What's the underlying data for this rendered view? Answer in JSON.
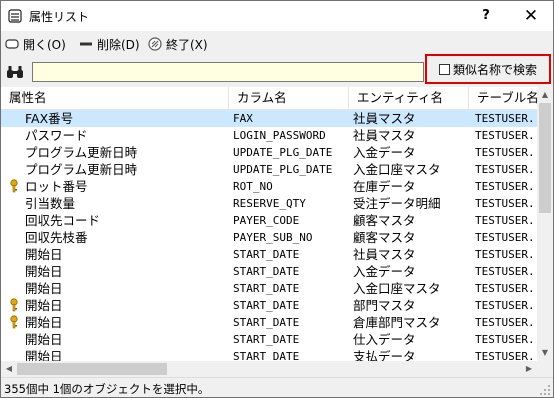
{
  "window": {
    "title": "属性リスト",
    "help": "?",
    "close": "✕"
  },
  "toolbar": {
    "open_label": "開く(O)",
    "delete_label": "削除(D)",
    "exit_label": "終了(X)"
  },
  "search": {
    "value": "",
    "similar_label": "類似名称で検索",
    "similar_checked": false
  },
  "table": {
    "columns": [
      "属性名",
      "カラム名",
      "エンティティ名",
      "テーブル名"
    ],
    "rows": [
      {
        "attr": "FAX番号",
        "column": "FAX",
        "entity": "社員マスタ",
        "table": "TESTUSER.",
        "key": false,
        "selected": true
      },
      {
        "attr": "パスワード",
        "column": "LOGIN_PASSWORD",
        "entity": "社員マスタ",
        "table": "TESTUSER.",
        "key": false
      },
      {
        "attr": "プログラム更新日時",
        "column": "UPDATE_PLG_DATE",
        "entity": "入金データ",
        "table": "TESTUSER.",
        "key": false
      },
      {
        "attr": "プログラム更新日時",
        "column": "UPDATE_PLG_DATE",
        "entity": "入金口座マスタ",
        "table": "TESTUSER.",
        "key": false
      },
      {
        "attr": "ロット番号",
        "column": "ROT_NO",
        "entity": "在庫データ",
        "table": "TESTUSER.",
        "key": true
      },
      {
        "attr": "引当数量",
        "column": "RESERVE_QTY",
        "entity": "受注データ明細",
        "table": "TESTUSER.",
        "key": false
      },
      {
        "attr": "回収先コード",
        "column": "PAYER_CODE",
        "entity": "顧客マスタ",
        "table": "TESTUSER.",
        "key": false
      },
      {
        "attr": "回収先枝番",
        "column": "PAYER_SUB_NO",
        "entity": "顧客マスタ",
        "table": "TESTUSER.",
        "key": false
      },
      {
        "attr": "開始日",
        "column": "START_DATE",
        "entity": "社員マスタ",
        "table": "TESTUSER.",
        "key": false
      },
      {
        "attr": "開始日",
        "column": "START_DATE",
        "entity": "入金データ",
        "table": "TESTUSER.",
        "key": false
      },
      {
        "attr": "開始日",
        "column": "START_DATE",
        "entity": "入金口座マスタ",
        "table": "TESTUSER.",
        "key": false
      },
      {
        "attr": "開始日",
        "column": "START_DATE",
        "entity": "部門マスタ",
        "table": "TESTUSER.",
        "key": true
      },
      {
        "attr": "開始日",
        "column": "START_DATE",
        "entity": "倉庫部門マスタ",
        "table": "TESTUSER.",
        "key": true
      },
      {
        "attr": "開始日",
        "column": "START_DATE",
        "entity": "仕入データ",
        "table": "TESTUSER.",
        "key": false
      },
      {
        "attr": "開始日",
        "column": "START_DATE",
        "entity": "支払データ",
        "table": "TESTUSER.",
        "key": false
      }
    ]
  },
  "status": {
    "text": "355個中 1個のオブジェクトを選択中。"
  },
  "colors": {
    "selection": "#cce8ff",
    "search_bg": "#ffffe1",
    "highlight_border": "#e00000",
    "key_icon": "#e0a810"
  }
}
